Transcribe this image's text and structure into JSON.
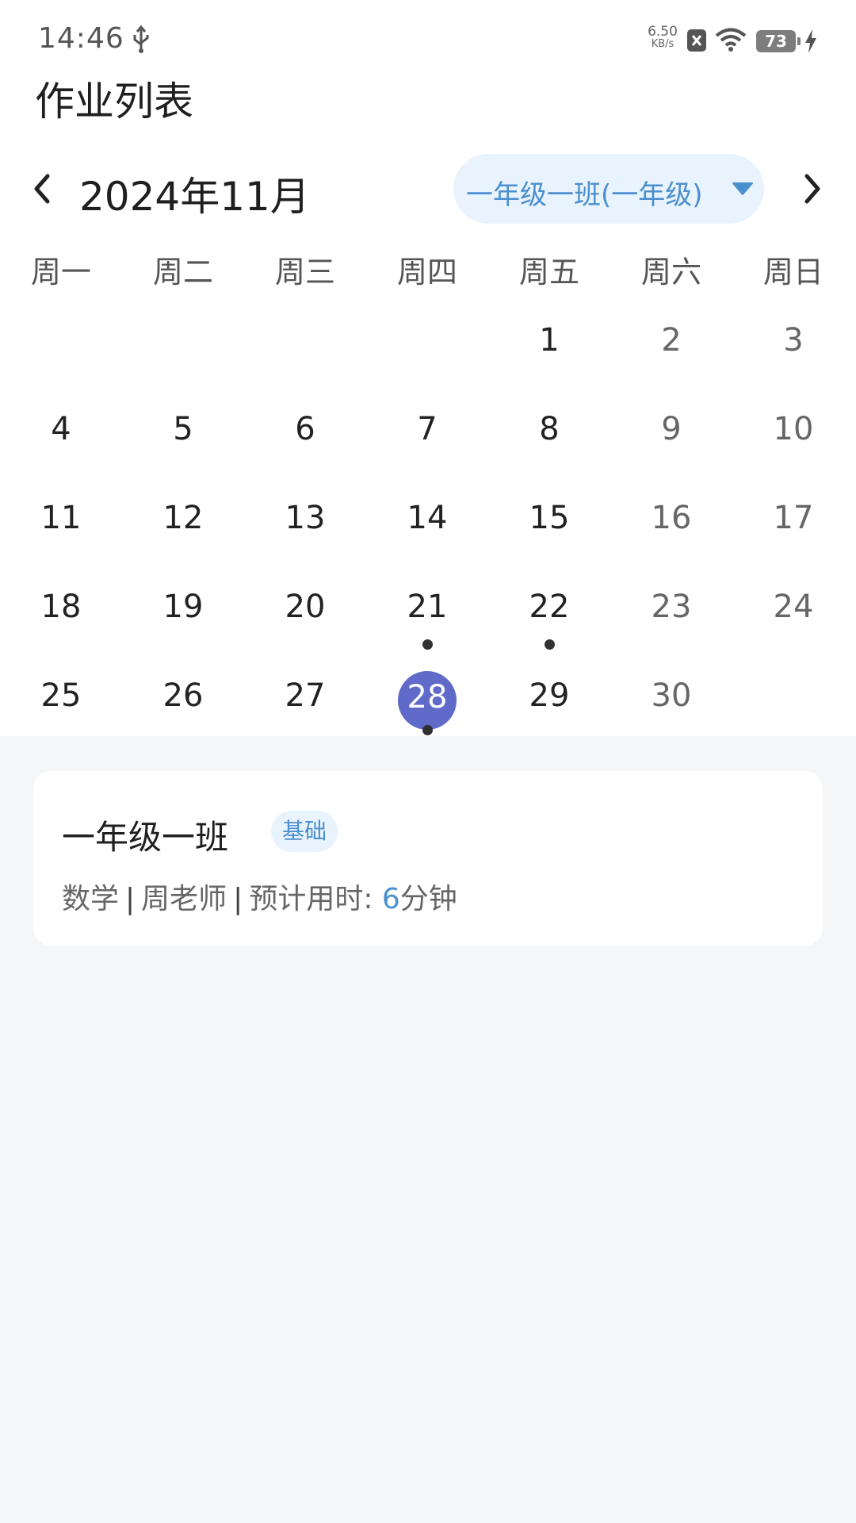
{
  "status_bar": {
    "time": "14:46",
    "net_speed_value": "6.50",
    "net_speed_unit": "KB/s",
    "battery_level": "73",
    "icons": [
      "usb-icon",
      "sim-blocked-icon",
      "wifi-icon",
      "battery-icon",
      "charging-icon"
    ]
  },
  "header": {
    "title": "作业列表"
  },
  "calendar": {
    "month_label": "2024年11月",
    "class_selector": "一年级一班(一年级)",
    "weekdays": [
      "周一",
      "周二",
      "周三",
      "周四",
      "周五",
      "周六",
      "周日"
    ],
    "weeks": [
      [
        "",
        "",
        "",
        "",
        "1",
        "2",
        "3"
      ],
      [
        "4",
        "5",
        "6",
        "7",
        "8",
        "9",
        "10"
      ],
      [
        "11",
        "12",
        "13",
        "14",
        "15",
        "16",
        "17"
      ],
      [
        "18",
        "19",
        "20",
        "21",
        "22",
        "23",
        "24"
      ],
      [
        "25",
        "26",
        "27",
        "28",
        "29",
        "30",
        ""
      ]
    ],
    "selected_day": "28",
    "days_with_homework": [
      "21",
      "22",
      "28"
    ]
  },
  "homework": [
    {
      "class_name": "一年级一班",
      "tag": "基础",
      "subject": "数学",
      "teacher": "周老师",
      "duration_label": "预计用时: ",
      "duration_value": "6",
      "duration_unit": "分钟"
    }
  ],
  "colors": {
    "accent": "#4a8fce",
    "accent_bg": "#e9f3fd",
    "selected_day": "#5f6ac9",
    "page_bg": "#f5f6f8"
  }
}
